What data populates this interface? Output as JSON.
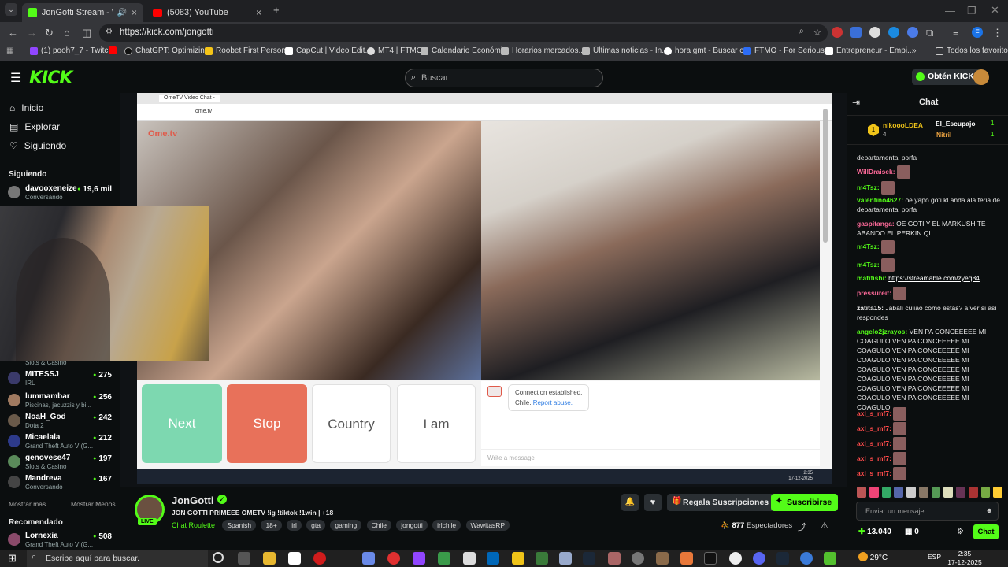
{
  "tabs": [
    {
      "title": "JonGotti Stream - Watch L"
    },
    {
      "title": "(5083) YouTube"
    }
  ],
  "url": "https://kick.com/jongotti",
  "bookmarks": [
    "(1) pooh7_7 - Twitch",
    "ChatGPT: Optimizin...",
    "Roobet First Person...",
    "CapCut | Video Edit...",
    "MT4 | FTMO",
    "Calendario Económi...",
    "Horarios mercados...",
    "Últimas noticias - In...",
    "hora gmt - Buscar c...",
    "FTMO - For Serious...",
    "Entrepreneur - Empi...",
    "Todos los favoritos"
  ],
  "header": {
    "logo": "KICK",
    "search_placeholder": "Buscar",
    "get_kicks": "Obtén KICKs"
  },
  "sidebar": {
    "nav": [
      "Inicio",
      "Explorar",
      "Siguiendo"
    ],
    "following_title": "Siguiendo",
    "channels": [
      {
        "name": "davooxeneize",
        "category": "Conversando",
        "viewers": "19,6 mil"
      },
      {
        "name": "MITESSJ",
        "category": "IRL",
        "viewers": "275"
      },
      {
        "name": "lummambar",
        "category": "Piscinas, jacuzzis y bi...",
        "viewers": "256"
      },
      {
        "name": "NoaH_God",
        "category": "Dota 2",
        "viewers": "242"
      },
      {
        "name": "Micaelala",
        "category": "Grand Theft Auto V (G...",
        "viewers": "212"
      },
      {
        "name": "genovese47",
        "category": "Slots & Casino",
        "viewers": "197"
      },
      {
        "name": "Mandreva",
        "category": "Conversando",
        "viewers": "167"
      }
    ],
    "hidden_category": "Slots & Casino",
    "show_more": "Mostrar más",
    "show_less": "Mostrar Menos",
    "recommended_title": "Recomendado",
    "recommended": [
      {
        "name": "Lornexia",
        "category": "Grand Theft Auto V (G...",
        "viewers": "508"
      }
    ]
  },
  "ometv": {
    "tab": "OmeTV Video Chat -",
    "url": "ome.tv",
    "logo": "Ome.tv",
    "buttons": {
      "next": "Next",
      "stop": "Stop",
      "country": "Country",
      "iam": "I am"
    },
    "connection": "Connection established.",
    "country_name": "Chile.",
    "report": "Report abuse.",
    "message_placeholder": "Write a message",
    "clock": "2:35",
    "date": "17-12-2025",
    "lang": "ESP"
  },
  "stream": {
    "channel": "JonGotti",
    "live": "LIVE",
    "title": "JON GOTTI PRIMEEE OMETV !ig !tiktok !1win | +18",
    "category": "Chat Roulette",
    "tags": [
      "Spanish",
      "18+",
      "irl",
      "gta",
      "gaming",
      "Chile",
      "jongotti",
      "irlchile",
      "WawitasRP"
    ],
    "gift_subs": "Regala Suscripciones",
    "subscribe": "Suscribirse",
    "viewers": "877",
    "viewers_label": "Espectadores"
  },
  "chat": {
    "title": "Chat",
    "leaders": [
      {
        "rank": "1",
        "name": "nikoooLDEA",
        "count": "4"
      },
      {
        "name": "El_Escupajo",
        "count": "1"
      },
      {
        "name": "Nitril",
        "count": "1"
      }
    ],
    "messages": [
      {
        "user": "",
        "text": "departamental porfa",
        "color": "#e8e8e8"
      },
      {
        "user": "WillDraisek:",
        "text": "",
        "color": "#ff6a9a",
        "emote": true
      },
      {
        "user": "m4Tsz:",
        "text": "",
        "color": "#53fc18",
        "emote": true
      },
      {
        "user": "valentino4627:",
        "text": "oe yapo goti kl anda ala feria de departamental porfa",
        "color": "#53fc18"
      },
      {
        "user": "gaspitanga:",
        "text": "OE GOTI Y EL MARKUSH TE ABANDO EL PERKIN QL",
        "color": "#ff6a9a"
      },
      {
        "user": "m4Tsz:",
        "text": "",
        "color": "#53fc18",
        "emote": true
      },
      {
        "user": "m4Tsz:",
        "text": "",
        "color": "#53fc18",
        "emote": true
      },
      {
        "user": "matifishi:",
        "text": "https://streamable.com/zyeq84",
        "color": "#53fc18"
      },
      {
        "user": "pressureit:",
        "text": "",
        "color": "#ff6a9a",
        "emote": true
      },
      {
        "user": "zatita15:",
        "text": "Jabalí culiao cómo estás? a ver si así respondes",
        "color": "#e8e8e8"
      },
      {
        "user": "angelo2jzrayos:",
        "text": "VEN PA CONCEEEEE MI COAGULO VEN PA CONCEEEEE MI COAGULO VEN PA CONCEEEEE MI COAGULO VEN PA CONCEEEEE MI COAGULO VEN PA CONCEEEEE MI COAGULO VEN PA CONCEEEEE MI COAGULO VEN PA CONCEEEEE MI COAGULO VEN PA CONCEEEEE MI COAGULO",
        "color": "#53fc18"
      },
      {
        "user": "axl_s_mf7:",
        "text": "",
        "color": "#ff4b4b",
        "emote": true
      },
      {
        "user": "axl_s_mf7:",
        "text": "",
        "color": "#ff4b4b",
        "emote": true
      },
      {
        "user": "axl_s_mf7:",
        "text": "",
        "color": "#ff4b4b",
        "emote": true
      },
      {
        "user": "axl_s_mf7:",
        "text": "",
        "color": "#ff4b4b",
        "emote": true
      },
      {
        "user": "axl_s_mf7:",
        "text": "",
        "color": "#ff4b4b",
        "emote": true
      }
    ],
    "input_placeholder": "Enviar un mensaje",
    "kicks": "13.040",
    "subs": "0",
    "send": "Chat"
  },
  "taskbar": {
    "search": "Escribe aquí para buscar.",
    "temp": "29°C",
    "lang": "ESP",
    "time": "2:35",
    "date": "17-12-2025"
  }
}
